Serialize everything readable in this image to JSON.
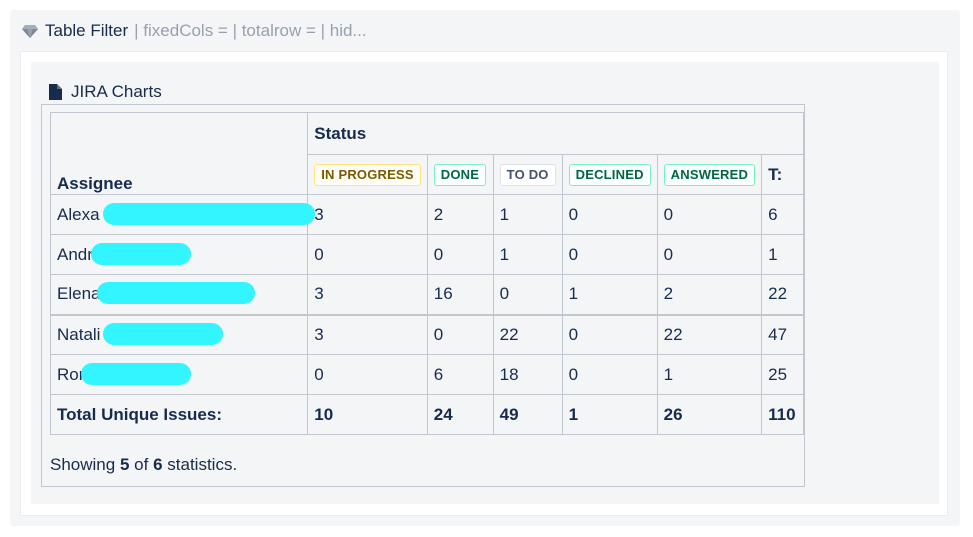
{
  "macro": {
    "title": "Table Filter",
    "params": "| fixedCols = | totalrow = | hid..."
  },
  "charts": {
    "title": "JIRA Charts"
  },
  "table": {
    "assignee_header": "Assignee",
    "status_header": "Status",
    "statuses": [
      "IN PROGRESS",
      "DONE",
      "TO DO",
      "DECLINED",
      "ANSWERED"
    ],
    "total_header": "T:",
    "rows": [
      {
        "name": "Alexa",
        "values": [
          "3",
          "2",
          "1",
          "0",
          "0"
        ],
        "total": "6"
      },
      {
        "name": "Andr",
        "values": [
          "0",
          "0",
          "1",
          "0",
          "0"
        ],
        "total": "1"
      },
      {
        "name": "Elena",
        "values": [
          "3",
          "16",
          "0",
          "1",
          "2"
        ],
        "total": "22"
      },
      {
        "name": "Natali",
        "values": [
          "3",
          "0",
          "22",
          "0",
          "22"
        ],
        "total": "47"
      },
      {
        "name": "Ror",
        "values": [
          "0",
          "6",
          "18",
          "0",
          "1"
        ],
        "total": "25"
      }
    ],
    "totals_label": "Total Unique Issues:",
    "totals": [
      "10",
      "24",
      "49",
      "1",
      "26"
    ],
    "grand_total": "110"
  },
  "footer": {
    "prefix": "Showing",
    "shown": "5",
    "of": "of",
    "count": "6",
    "suffix": "statistics."
  },
  "colors": {
    "redaction": "#33f5ff",
    "in_progress": "#7a5a00",
    "done": "#006644",
    "todo": "#42526e"
  },
  "icons": {
    "macro": "gem-icon",
    "charts": "document-icon"
  }
}
